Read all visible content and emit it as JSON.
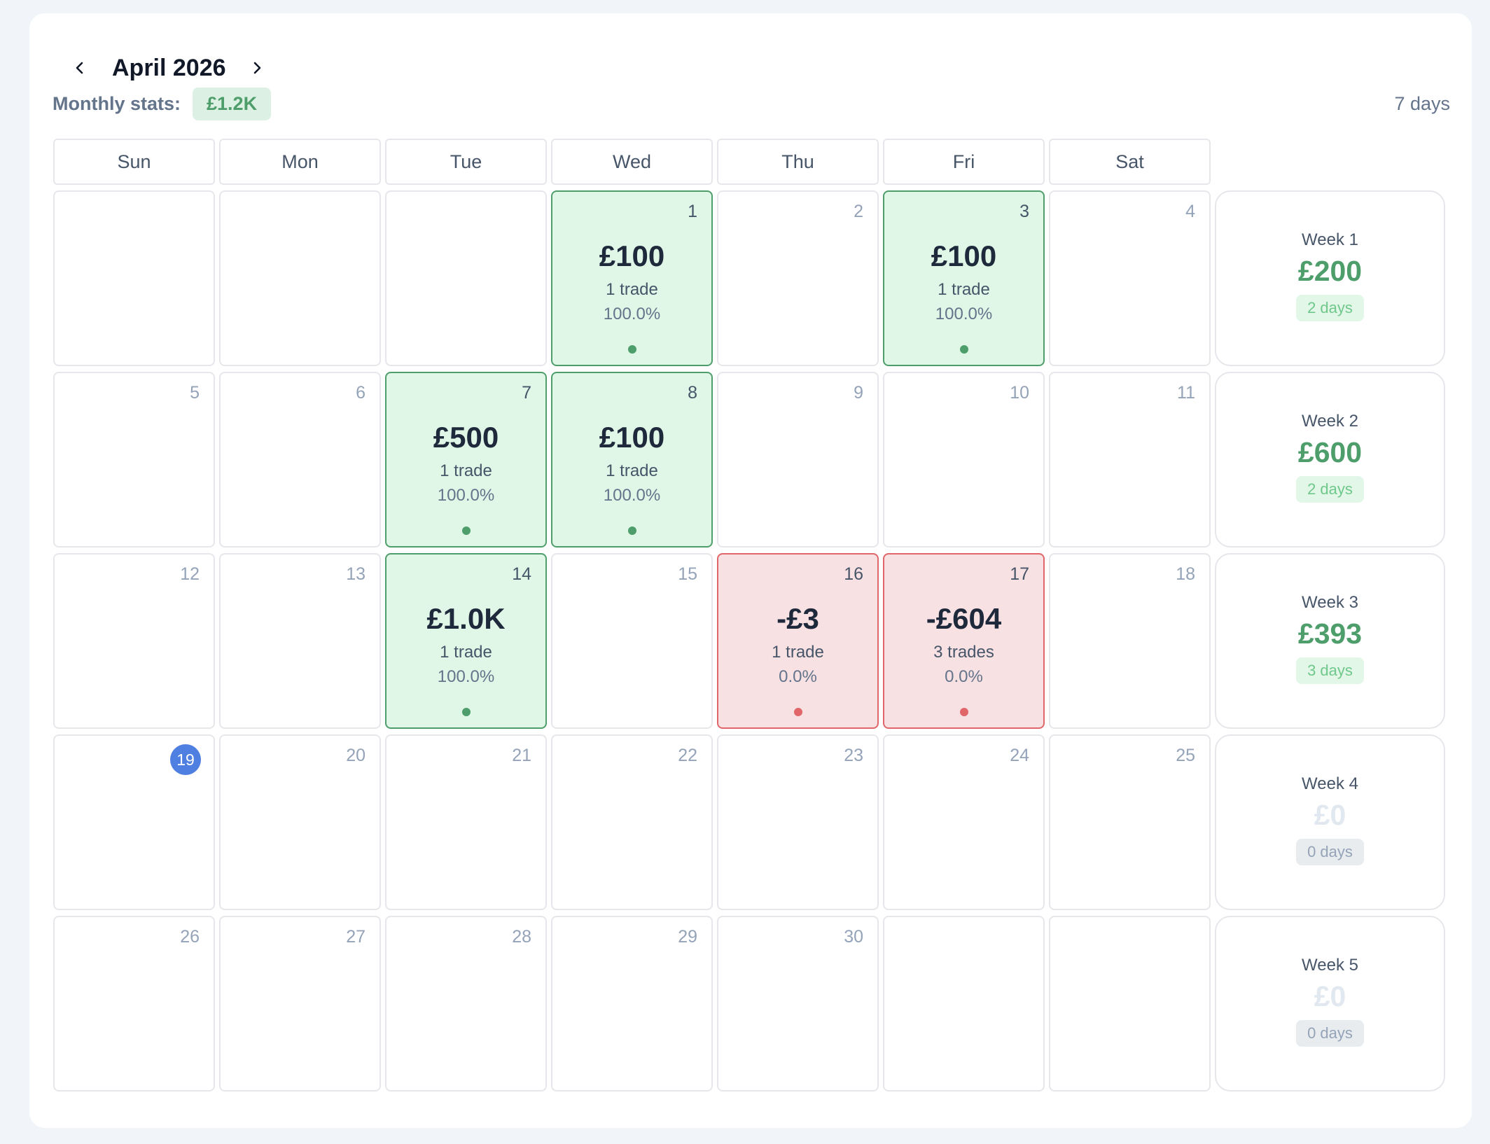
{
  "calendar": {
    "month_title": "April 2026",
    "stats_label": "Monthly stats:",
    "stats_value": "£1.2K",
    "days_count": "7 days",
    "weekdays": [
      "Sun",
      "Mon",
      "Tue",
      "Wed",
      "Thu",
      "Fri",
      "Sat"
    ],
    "colors": {
      "win": "#4e9e6b",
      "loss": "#e0666a",
      "today": "#4f7fe0"
    },
    "weeks": [
      {
        "label": "Week 1",
        "total": "£200",
        "days": "2 days",
        "status": "pos",
        "cells": [
          {
            "num": ""
          },
          {
            "num": ""
          },
          {
            "num": ""
          },
          {
            "num": "1",
            "status": "win",
            "pnl": "£100",
            "trades": "1 trade",
            "rate": "100.0%"
          },
          {
            "num": "2"
          },
          {
            "num": "3",
            "status": "win",
            "pnl": "£100",
            "trades": "1 trade",
            "rate": "100.0%"
          },
          {
            "num": "4"
          }
        ]
      },
      {
        "label": "Week 2",
        "total": "£600",
        "days": "2 days",
        "status": "pos",
        "cells": [
          {
            "num": "5"
          },
          {
            "num": "6"
          },
          {
            "num": "7",
            "status": "win",
            "pnl": "£500",
            "trades": "1 trade",
            "rate": "100.0%"
          },
          {
            "num": "8",
            "status": "win",
            "pnl": "£100",
            "trades": "1 trade",
            "rate": "100.0%"
          },
          {
            "num": "9"
          },
          {
            "num": "10"
          },
          {
            "num": "11"
          }
        ]
      },
      {
        "label": "Week 3",
        "total": "£393",
        "days": "3 days",
        "status": "pos",
        "cells": [
          {
            "num": "12"
          },
          {
            "num": "13"
          },
          {
            "num": "14",
            "status": "win",
            "pnl": "£1.0K",
            "trades": "1 trade",
            "rate": "100.0%"
          },
          {
            "num": "15"
          },
          {
            "num": "16",
            "status": "loss",
            "pnl": "-£3",
            "trades": "1 trade",
            "rate": "0.0%"
          },
          {
            "num": "17",
            "status": "loss",
            "pnl": "-£604",
            "trades": "3 trades",
            "rate": "0.0%"
          },
          {
            "num": "18"
          }
        ]
      },
      {
        "label": "Week 4",
        "total": "£0",
        "days": "0 days",
        "status": "zero",
        "cells": [
          {
            "num": "19",
            "today": true
          },
          {
            "num": "20"
          },
          {
            "num": "21"
          },
          {
            "num": "22"
          },
          {
            "num": "23"
          },
          {
            "num": "24"
          },
          {
            "num": "25"
          }
        ]
      },
      {
        "label": "Week 5",
        "total": "£0",
        "days": "0 days",
        "status": "zero",
        "cells": [
          {
            "num": "26"
          },
          {
            "num": "27"
          },
          {
            "num": "28"
          },
          {
            "num": "29"
          },
          {
            "num": "30"
          },
          {
            "num": ""
          },
          {
            "num": ""
          }
        ]
      }
    ]
  }
}
